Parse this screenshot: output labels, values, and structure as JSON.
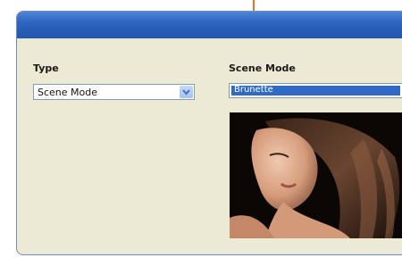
{
  "type_section": {
    "label": "Type",
    "selected": "Scene Mode"
  },
  "scene_section": {
    "label": "Scene Mode",
    "selected": "Brunette"
  },
  "colors": {
    "titlebar": "#2f64bf",
    "window_bg": "#ece9d4",
    "selection": "#316ac5",
    "callout": "#e0742a"
  },
  "icons": {
    "dropdown": "chevron-down-icon"
  }
}
